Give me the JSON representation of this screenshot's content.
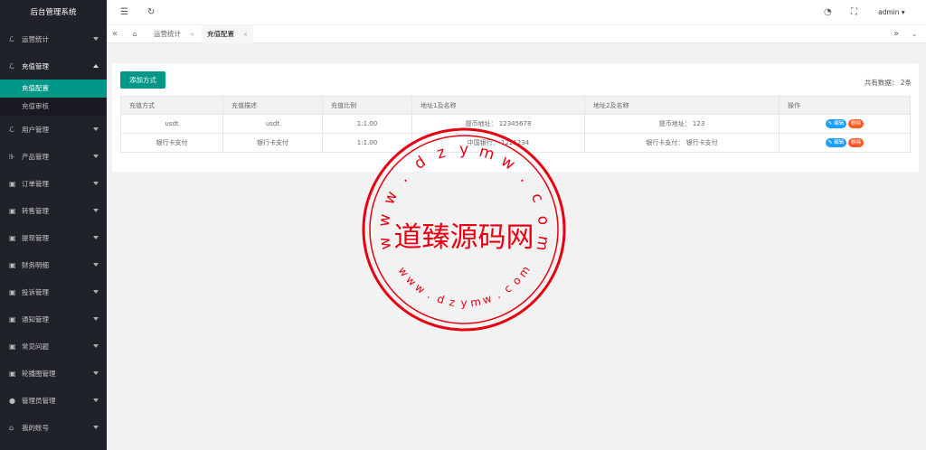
{
  "sidebar": {
    "title": "后台管理系统",
    "items": [
      {
        "label": "运营统计",
        "icon": "chart-icon",
        "open": false
      },
      {
        "label": "充值管理",
        "icon": "wallet-icon",
        "open": true,
        "children": [
          {
            "label": "充值配置",
            "active": true
          },
          {
            "label": "充值审核",
            "active": false
          }
        ]
      },
      {
        "label": "用户管理",
        "icon": "user-icon",
        "open": false
      },
      {
        "label": "产品管理",
        "icon": "product-icon",
        "open": false
      },
      {
        "label": "订单管理",
        "icon": "order-icon",
        "open": false
      },
      {
        "label": "转售管理",
        "icon": "resale-icon",
        "open": false
      },
      {
        "label": "提现管理",
        "icon": "withdraw-icon",
        "open": false
      },
      {
        "label": "财务明细",
        "icon": "finance-icon",
        "open": false
      },
      {
        "label": "投诉管理",
        "icon": "complaint-icon",
        "open": false
      },
      {
        "label": "通知管理",
        "icon": "notice-icon",
        "open": false
      },
      {
        "label": "常见问题",
        "icon": "faq-icon",
        "open": false
      },
      {
        "label": "轮播图管理",
        "icon": "carousel-icon",
        "open": false
      },
      {
        "label": "管理员管理",
        "icon": "admin-icon",
        "open": false
      },
      {
        "label": "我的账号",
        "icon": "account-icon",
        "open": false
      }
    ]
  },
  "header": {
    "user": "admin"
  },
  "tabs": [
    {
      "label": "运营统计"
    },
    {
      "label": "充值配置",
      "active": true
    }
  ],
  "toolbar": {
    "add_label": "添加方式",
    "total_label": "共有数据： 2条"
  },
  "table": {
    "columns": [
      "充值方式",
      "充值描述",
      "充值比例",
      "地址1及名称",
      "地址2及名称",
      "操作"
    ],
    "rows": [
      {
        "method": "usdt",
        "desc": "usdt",
        "ratio": "1:1.00",
        "addr1": "提币地址： 12345678",
        "addr2": "提币地址： 123",
        "edit": "编辑",
        "del": "删除"
      },
      {
        "method": "银行卡支付",
        "desc": "银行卡支付",
        "ratio": "1:1.00",
        "addr1": "中国银行： 1221234",
        "addr2": "银行卡支付： 银行卡支付",
        "edit": "编辑",
        "del": "删除"
      }
    ]
  },
  "watermark": {
    "text": "道臻源码网",
    "url": "www.dzymw.com"
  },
  "colors": {
    "sidebar": "#20222a",
    "accent": "#009688",
    "edit": "#1e9fff",
    "delete": "#ff5722",
    "stamp": "#e60012"
  }
}
